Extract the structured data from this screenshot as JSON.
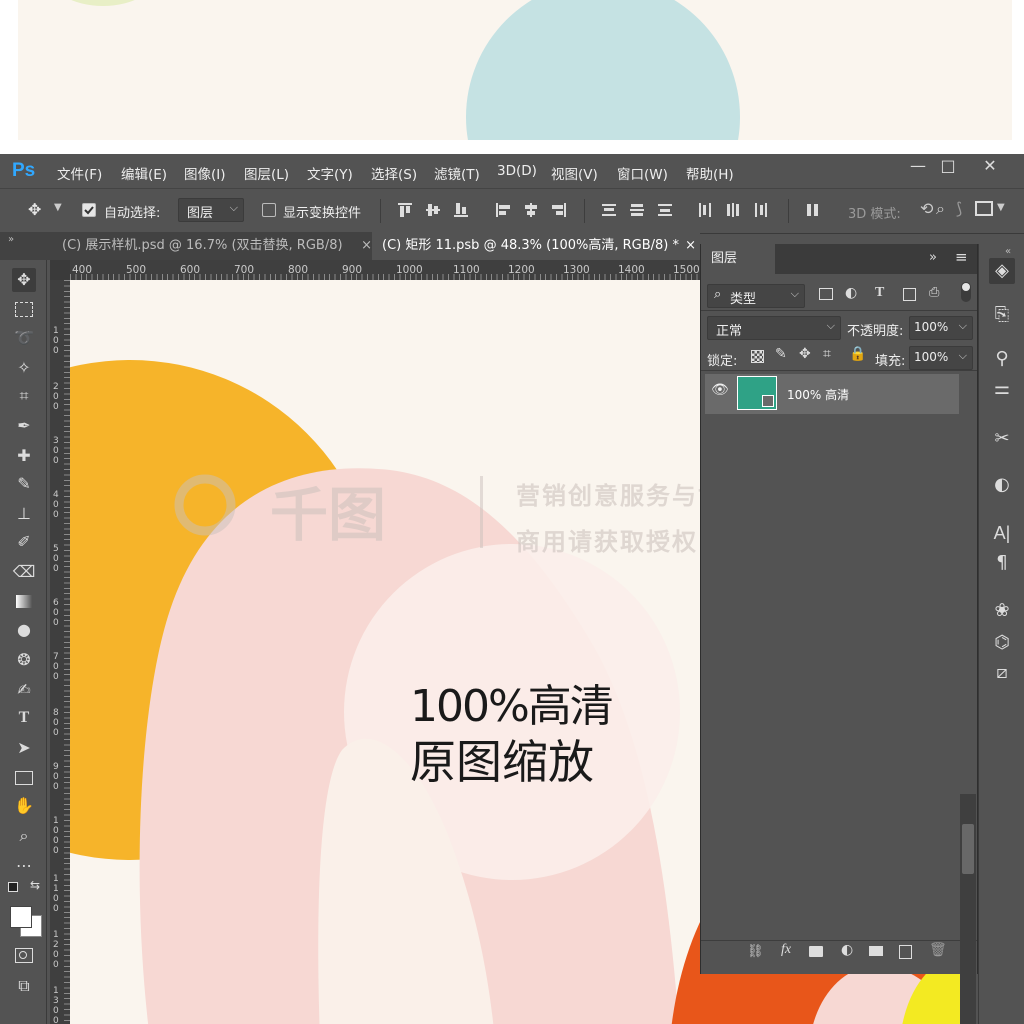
{
  "app": {
    "logo": "Ps",
    "color_accent": "#31a8ff"
  },
  "menu": [
    "文件(F)",
    "编辑(E)",
    "图像(I)",
    "图层(L)",
    "文字(Y)",
    "选择(S)",
    "滤镜(T)",
    "3D(D)",
    "视图(V)",
    "窗口(W)",
    "帮助(H)"
  ],
  "window_controls": {
    "minimize": "—",
    "maximize": "□",
    "close": "✕"
  },
  "options": {
    "auto_select_label": "自动选择:",
    "auto_select_value": "图层",
    "show_transform_label": "显示变换控件",
    "mode_3d_label": "3D 模式:"
  },
  "tabs": [
    {
      "label": "(C) 展示样机.psd @ 16.7% (双击替换, RGB/8)",
      "close": "×"
    },
    {
      "label": "(C) 矩形 11.psb @ 48.3% (100%高清, RGB/8) *",
      "close": "×"
    }
  ],
  "ruler_h": [
    "400",
    "500",
    "600",
    "700",
    "800",
    "900",
    "1000",
    "1100",
    "1200",
    "1300",
    "1400",
    "1500"
  ],
  "ruler_v": [
    "1 0 0",
    "2 0 0",
    "3 0 0",
    "4 0 0",
    "5 0 0",
    "6 0 0",
    "7 0 0",
    "8 0 0",
    "9 0 0",
    "1 0 0 0",
    "1 1 0 0",
    "1 2 0 0",
    "1 3 0 0"
  ],
  "canvas": {
    "line1": "100%高清",
    "line2": "原图缩放",
    "watermark_brand": "千图",
    "watermark_line1": "营销创意服务与协作平台",
    "watermark_line2": "商用请获取授权",
    "colors": {
      "bg": "#faf5ee",
      "yellow": "#f6b42a",
      "pink": "#f7d8d3",
      "orange": "#e8561a",
      "lemon": "#f3ea22",
      "teal": "#2fa286"
    }
  },
  "layers_panel": {
    "title": "图层",
    "filter_label": "类型",
    "blend_mode": "正常",
    "opacity_label": "不透明度:",
    "opacity_value": "100%",
    "lock_label": "锁定:",
    "fill_label": "填充:",
    "fill_value": "100%",
    "layer_name": "100% 高清"
  }
}
